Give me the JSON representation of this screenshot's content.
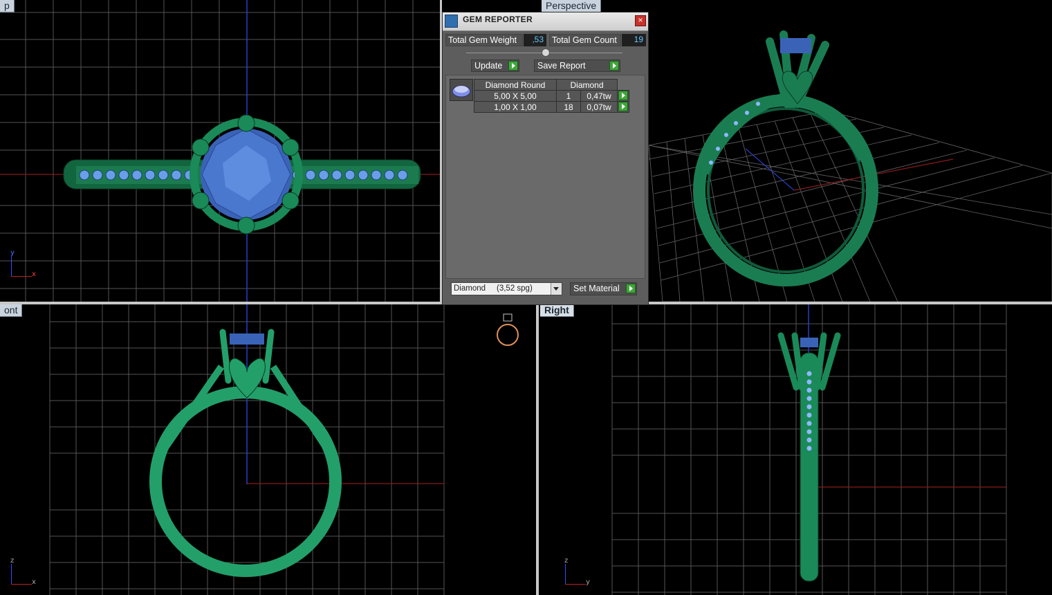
{
  "viewports": {
    "top": {
      "label": "p"
    },
    "perspective": {
      "label": "Perspective"
    },
    "front": {
      "label": "ont"
    },
    "right": {
      "label": "Right"
    }
  },
  "axes": {
    "top": {
      "v": "y",
      "h": "x"
    },
    "front": {
      "v": "z",
      "h": "x"
    },
    "right": {
      "v": "z",
      "h": "y"
    }
  },
  "gem_reporter": {
    "title": "GEM REPORTER",
    "close": "×",
    "total_weight_label": "Total Gem Weight",
    "total_weight_value": ",53",
    "total_count_label": "Total Gem Count",
    "total_count_value": "19",
    "update_label": "Update",
    "save_report_label": "Save Report",
    "table": {
      "col1": "Diamond Round",
      "col2": "Diamond",
      "rows": [
        {
          "size": "5,00 X 5,00",
          "count": "1",
          "weight": "0,47tw"
        },
        {
          "size": "1,00 X 1,00",
          "count": "18",
          "weight": "0,07tw"
        }
      ]
    },
    "material_select": "Diamond     (3,52 spg)",
    "set_material_label": "Set Material"
  },
  "colors": {
    "metal": "#1f8a5c",
    "gem": "#4a76c9",
    "grid": "#5a5a5a"
  }
}
